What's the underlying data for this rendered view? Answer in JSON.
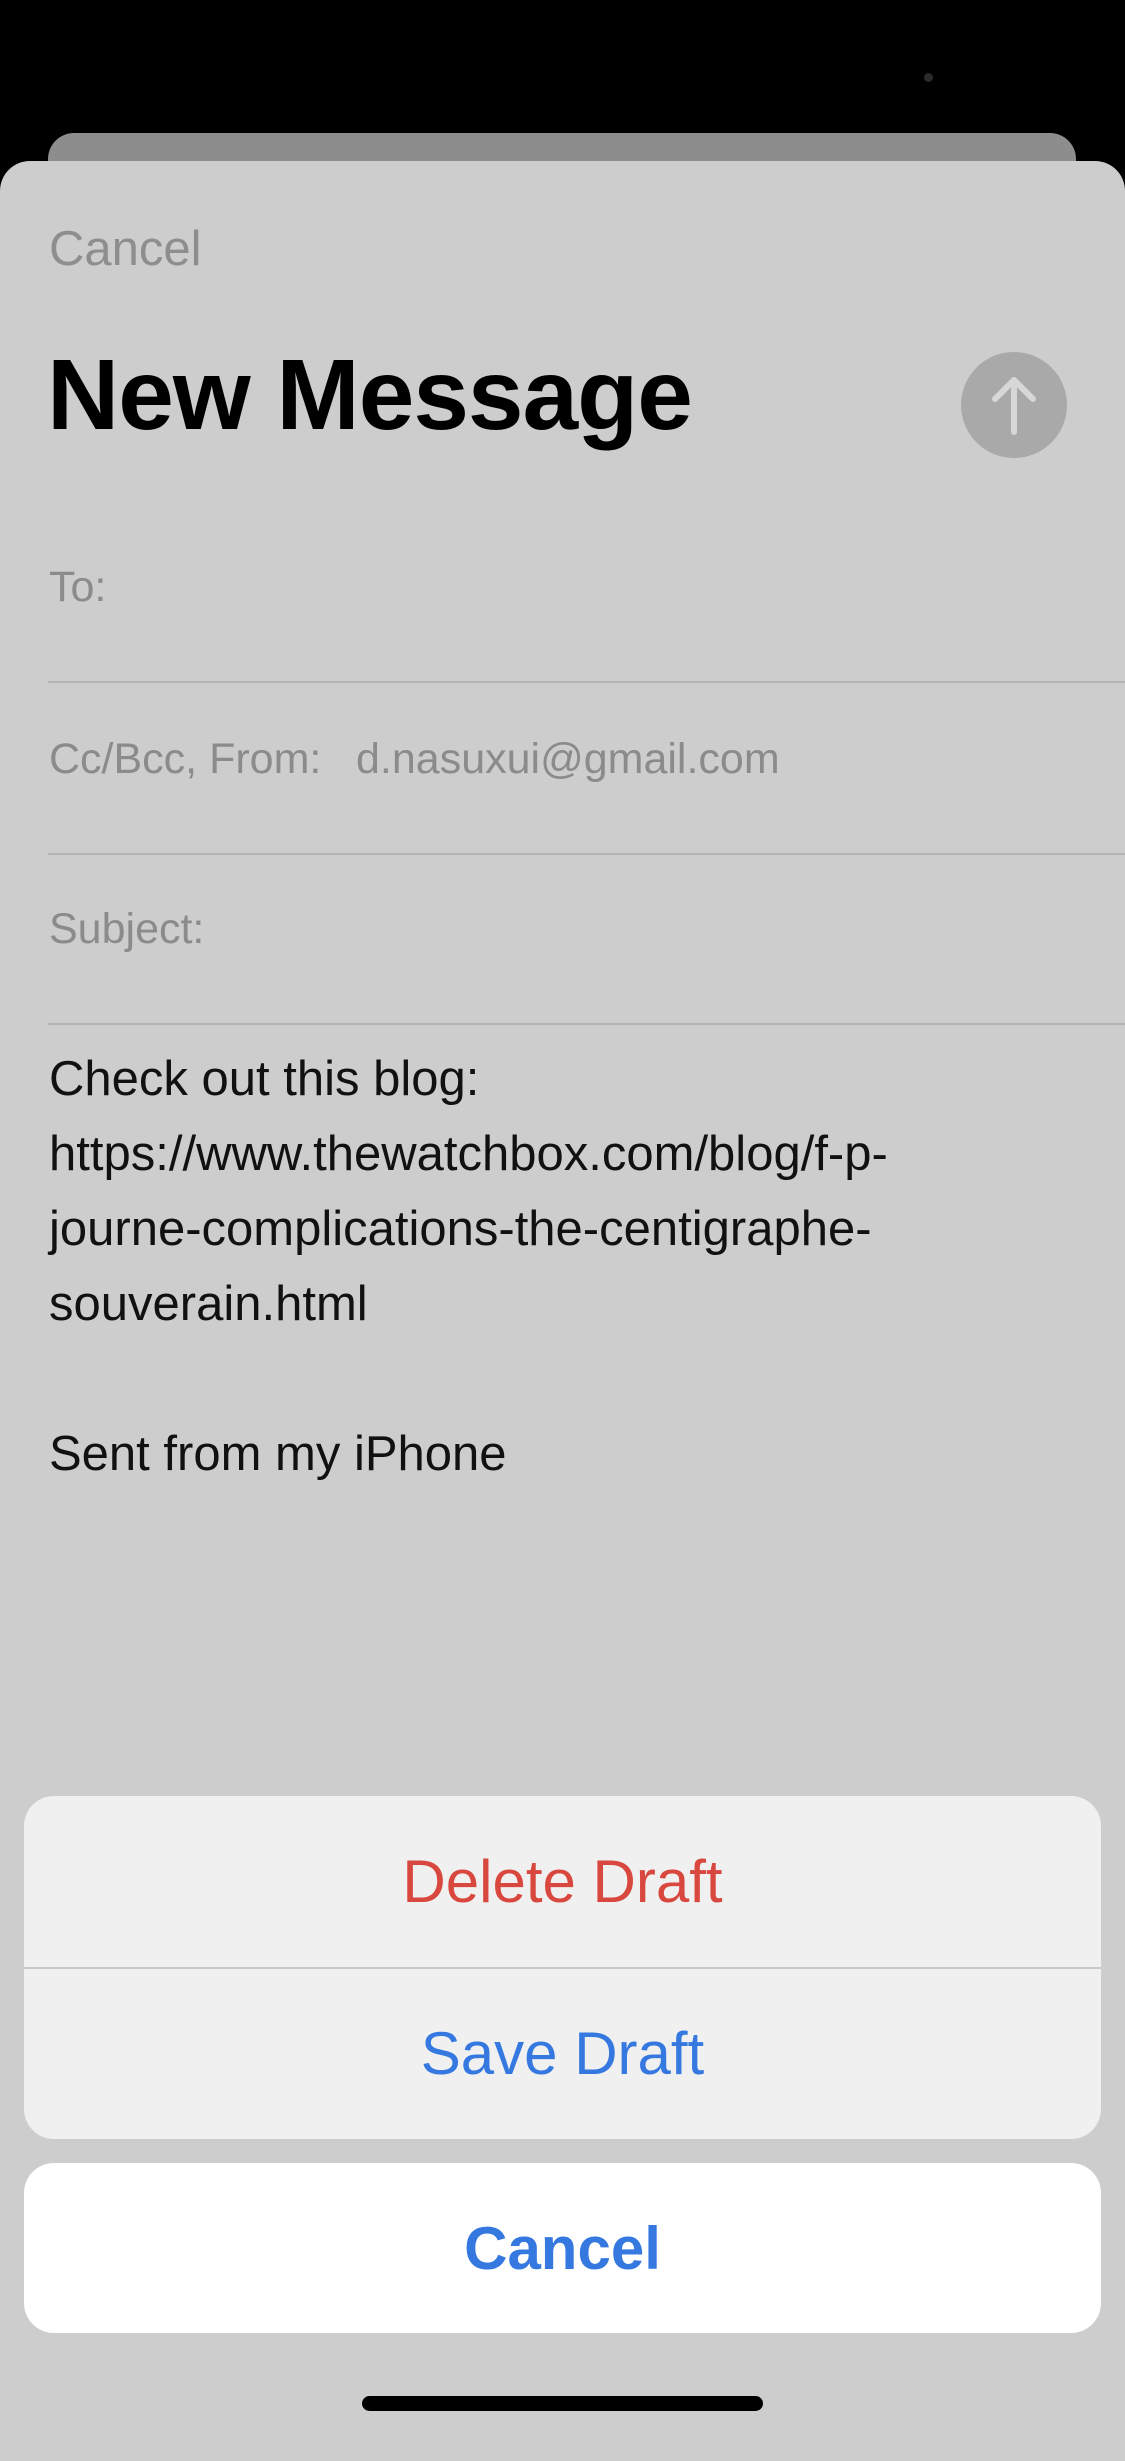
{
  "header": {
    "cancel_label": "Cancel",
    "title": "New Message",
    "send_icon": "arrow-up-icon"
  },
  "fields": {
    "to_label": "To:",
    "ccbcc_label": "Cc/Bcc, From:",
    "from_value": "d.nasuxui@gmail.com",
    "subject_label": "Subject:"
  },
  "body": {
    "lines": [
      "Check out this blog:",
      "https://www.thewatchbox.com/blog/f-p-",
      "journe-complications-the-centigraphe-",
      "souverain.html",
      "",
      "Sent from my iPhone"
    ]
  },
  "action_sheet": {
    "delete_label": "Delete Draft",
    "save_label": "Save Draft",
    "cancel_label": "Cancel"
  },
  "colors": {
    "destructive": "#d9483f",
    "accent": "#3478e0"
  }
}
